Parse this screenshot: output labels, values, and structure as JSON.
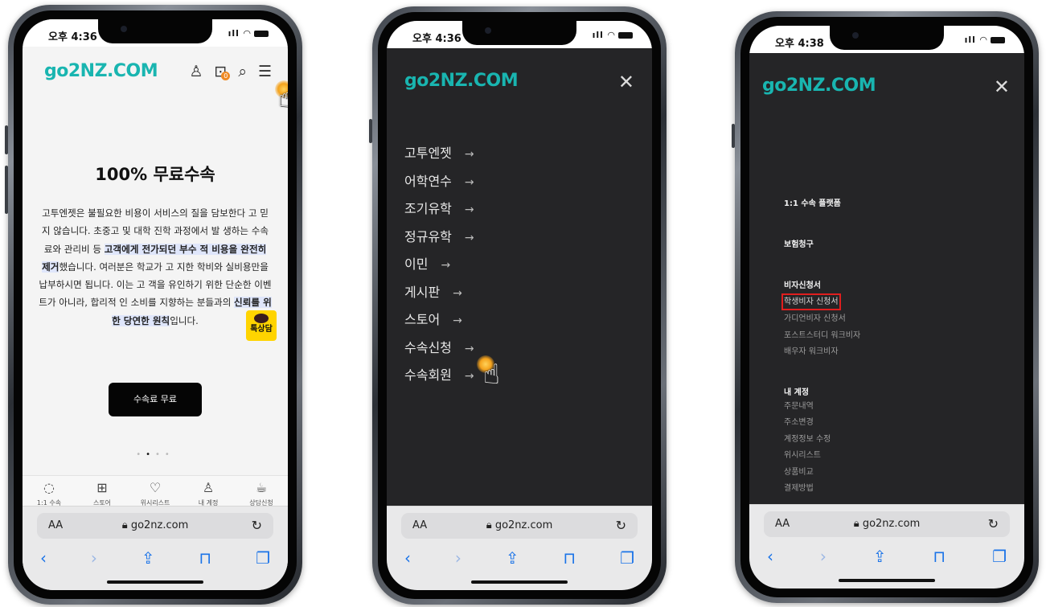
{
  "status": {
    "time_1": "오후 4:36",
    "time_2": "오후 4:36",
    "time_3": "오후 4:38"
  },
  "brand": {
    "logo": "go2NZ.COM",
    "color": "#19b5b0"
  },
  "phone1": {
    "header_icons": [
      "user-icon",
      "bag-icon",
      "search-icon",
      "hamburger-menu-icon"
    ],
    "cart_badge": "0",
    "hero": {
      "title": "100% 무료수속",
      "p1": "고투엔젯은 불필요한 비용이 서비스의 질을 담보한다 고 믿지 않습니다. 초중고 및 대학 진학 과정에서 발 생하는 수속료와 관리비 등 ",
      "p2": "고객에게 전가되던 부수 적 비용을 완전히 제거",
      "p3": "했습니다. 여러분은 학교가 고 지한 학비와 실비용만을 납부하시면 됩니다. 이는 고 객을 유인하기 위한 단순한 이벤트가 아니라, 합리적 인 소비를 지향하는 분들과의 ",
      "p4": "신뢰를 위한 당연한 원칙",
      "p5": "입니다.",
      "cta": "수속료 무료"
    },
    "kakao_label": "톡상담",
    "bottom_nav": [
      {
        "label": "1:1 수속",
        "icon": "chat-icon"
      },
      {
        "label": "스토어",
        "icon": "gift-icon"
      },
      {
        "label": "위시리스트",
        "icon": "heart-icon"
      },
      {
        "label": "내 계정",
        "icon": "user-icon"
      },
      {
        "label": "상담신청",
        "icon": "coffee-icon"
      }
    ]
  },
  "phone2": {
    "menu": [
      "고투엔젯",
      "어학연수",
      "조기유학",
      "정규유학",
      "이민",
      "게시판",
      "스토어",
      "수속신청",
      "수속회원"
    ],
    "arrow": "→"
  },
  "phone3": {
    "sections": {
      "s1": "1:1 수속 플랫폼",
      "s2": "보험청구",
      "s3": "비자신청서",
      "s3_links": [
        "학생비자 신청서",
        "가디언비자 신청서",
        "포스트스터디 워크비자",
        "배우자 워크비자"
      ],
      "s4": "내 계정",
      "s4_links": [
        "주문내역",
        "주소변경",
        "계정정보 수정",
        "위시리스트",
        "상품비교",
        "결제방법"
      ]
    }
  },
  "safari": {
    "aa": "AA",
    "url": "go2nz.com"
  }
}
